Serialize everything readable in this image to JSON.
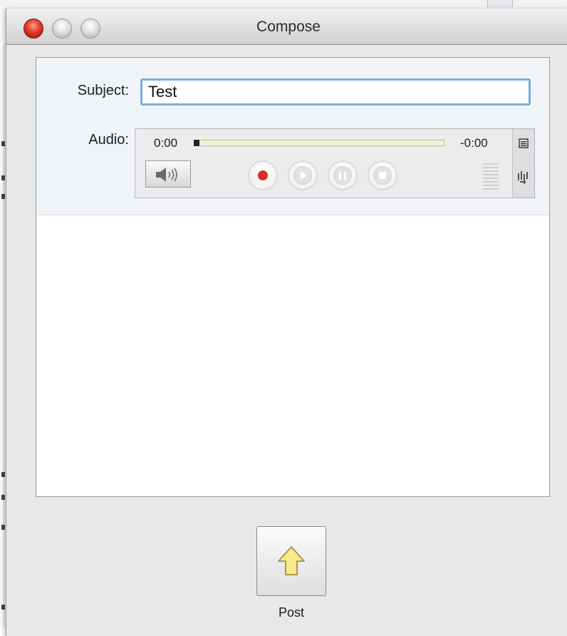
{
  "window": {
    "title": "Compose",
    "buttons": [
      "close",
      "minimize",
      "zoom"
    ]
  },
  "form": {
    "subject_label": "Subject:",
    "subject_value": "Test",
    "audio_label": "Audio:"
  },
  "audio": {
    "elapsed": "0:00",
    "remaining": "-0:00",
    "progress": 0,
    "controls": [
      "record",
      "play",
      "pause",
      "stop"
    ],
    "icons": [
      "speaker-icon",
      "menu-icon",
      "waveform-icon"
    ]
  },
  "actions": {
    "post_label": "Post"
  },
  "colors": {
    "record": "#dc2c1f",
    "focus_ring": "#7ea9de",
    "arrow_fill": "#f6ea8a"
  }
}
